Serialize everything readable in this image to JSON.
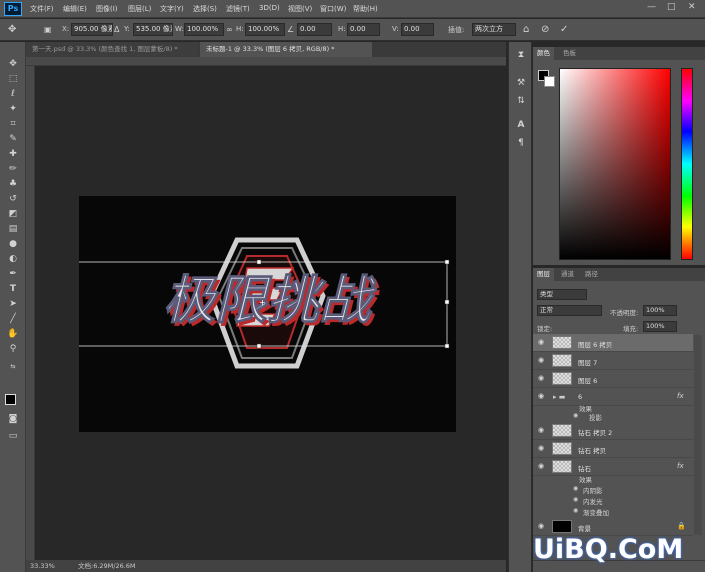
{
  "app": {
    "logo": "Ps"
  },
  "menu": [
    "文件(F)",
    "编辑(E)",
    "图像(I)",
    "图层(L)",
    "文字(Y)",
    "选择(S)",
    "滤镜(T)",
    "3D(D)",
    "视图(V)",
    "窗口(W)",
    "帮助(H)"
  ],
  "window_controls": {
    "minimize": "—",
    "maximize": "□",
    "close": "✕"
  },
  "options": {
    "x_label": "X:",
    "x_value": "905.00 像素",
    "y_label": "Y:",
    "y_value": "535.00 像素",
    "w_label": "W:",
    "w_value": "100.00%",
    "h_label": "H:",
    "h_value": "100.00%",
    "angle_value": "0.00",
    "hskew_label": "H:",
    "hskew_value": "0.00",
    "vskew_label": "V:",
    "vskew_value": "0.00",
    "interp_label": "插值:",
    "interp_value": "两次立方"
  },
  "tabs": [
    {
      "label": "第一天.psd @ 33.3% (颜色查找 1, 图层蒙板/8) *",
      "active": false
    },
    {
      "label": "未标题-1 @ 33.3% (图层 6 拷贝, RGB/8) *",
      "active": true
    }
  ],
  "artwork_text": "极限挑战",
  "status": {
    "zoom": "33.33%",
    "doc": "文档:6.29M/26.6M"
  },
  "color_panel": {
    "tabs": [
      "颜色",
      "色板"
    ],
    "base_color": "#ff0000"
  },
  "layers_panel": {
    "tabs": [
      "图层",
      "通道",
      "路径"
    ],
    "filter_kind": "类型",
    "blend_mode": "正常",
    "opacity_label": "不透明度:",
    "opacity_value": "100%",
    "lock_label": "锁定:",
    "fill_label": "填充:",
    "fill_value": "100%",
    "layers": [
      {
        "name": "图层 6 拷贝",
        "selected": true,
        "fx": ""
      },
      {
        "name": "图层 7",
        "selected": false,
        "fx": ""
      },
      {
        "name": "图层 6",
        "selected": false,
        "fx": ""
      },
      {
        "name": "6",
        "selected": false,
        "fx": "fx"
      },
      {
        "name": "钻石 拷贝 2",
        "selected": false,
        "fx": ""
      },
      {
        "name": "钻石 拷贝",
        "selected": false,
        "fx": ""
      },
      {
        "name": "钻石",
        "selected": false,
        "fx": "fx"
      },
      {
        "name": "背景",
        "selected": false,
        "fx": ""
      }
    ],
    "effects_group6": {
      "title": "效果",
      "items": [
        "投影"
      ]
    },
    "effects_diamond": {
      "title": "效果",
      "items": [
        "内阴影",
        "内发光",
        "渐变叠加"
      ]
    }
  },
  "watermark": "UiBQ.CoM"
}
